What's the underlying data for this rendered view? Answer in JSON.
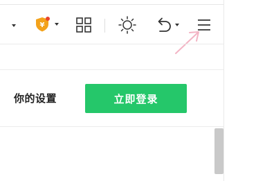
{
  "toolbar": {
    "icons": {
      "left_chevron": "chevron-down-icon",
      "shield": "shield-yuan-icon",
      "shield_symbol": "¥",
      "shield_dropdown": "chevron-down-icon",
      "apps": "grid-icon",
      "theme": "sun-icon",
      "undo": "undo-icon",
      "undo_dropdown": "chevron-down-icon",
      "menu": "hamburger-menu-icon"
    },
    "colors": {
      "shield_orange": "#f3a21b",
      "shield_badge_red": "#e8442d",
      "annotation_arrow_pink": "#f3b4c4"
    }
  },
  "login": {
    "prompt_text": "你的设置",
    "button_label": "立即登录",
    "button_color": "#25c76a"
  }
}
